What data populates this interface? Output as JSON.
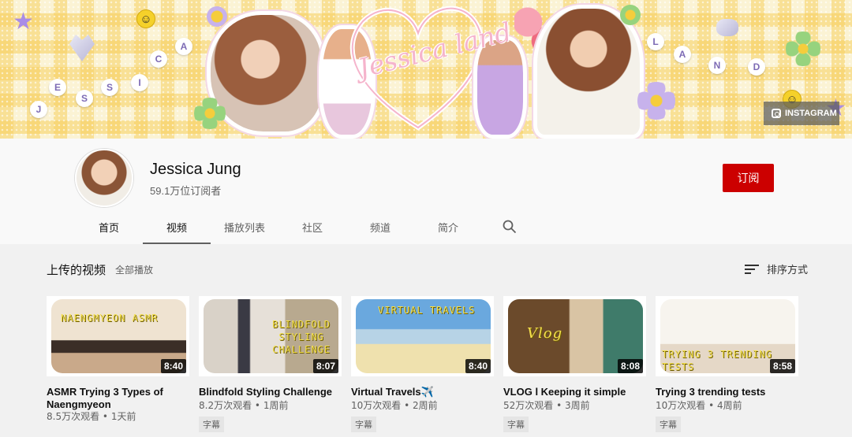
{
  "banner": {
    "logo_text": "Jessica land",
    "instagram_label": "INSTAGRAM",
    "beads_left": [
      "J",
      "E",
      "S",
      "S",
      "I",
      "C",
      "A"
    ],
    "beads_right": [
      "L",
      "A",
      "N",
      "D"
    ]
  },
  "channel": {
    "name": "Jessica Jung",
    "subscribers": "59.1万位订阅者",
    "subscribe_label": "订阅"
  },
  "tabs": [
    {
      "label": "首页"
    },
    {
      "label": "视频"
    },
    {
      "label": "播放列表"
    },
    {
      "label": "社区"
    },
    {
      "label": "频道"
    },
    {
      "label": "简介"
    }
  ],
  "active_tab": "视频",
  "section": {
    "title": "上传的视频",
    "play_all": "全部播放",
    "sort_label": "排序方式"
  },
  "videos": [
    {
      "title": "ASMR Trying 3 Types of Naengmyeon",
      "duration": "8:40",
      "views": "8.5万次观看",
      "age": "1天前",
      "overlay": "NAENGMYEON ASMR",
      "badge": ""
    },
    {
      "title": "Blindfold Styling Challenge",
      "duration": "8:07",
      "views": "8.2万次观看",
      "age": "1周前",
      "overlay": "BLINDFOLD STYLING CHALLENGE",
      "badge": "字幕"
    },
    {
      "title": "Virtual Travels✈️",
      "duration": "8:40",
      "views": "10万次观看",
      "age": "2周前",
      "overlay": "VIRTUAL TRAVELS",
      "badge": "字幕"
    },
    {
      "title": "VLOG l Keeping it simple",
      "duration": "8:08",
      "views": "52万次观看",
      "age": "3周前",
      "overlay": "Vlog",
      "badge": "字幕"
    },
    {
      "title": "Trying 3 trending tests",
      "duration": "8:58",
      "views": "10万次观看",
      "age": "4周前",
      "overlay": "TRYING 3 TRENDING TESTS",
      "badge": "字幕"
    }
  ],
  "colors": {
    "subscribe_bg": "#cc0000",
    "banner_check": "#f7d060",
    "overlay_text": "#f4e04d"
  },
  "icons": {
    "search": "search-icon",
    "sort": "sort-icon",
    "instagram": "instagram-icon"
  }
}
